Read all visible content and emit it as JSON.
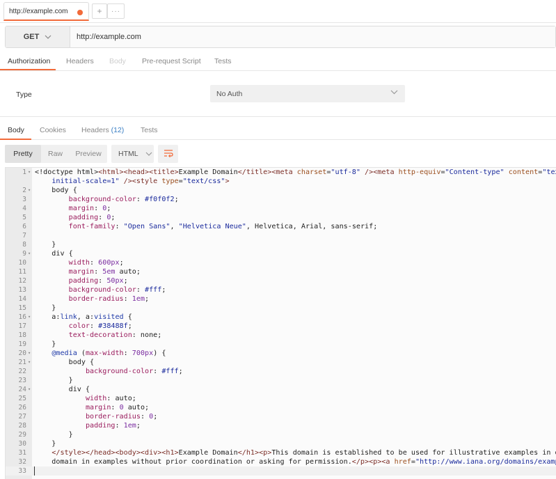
{
  "tab": {
    "url": "http://example.com",
    "add_label": "+",
    "more_label": "···"
  },
  "request": {
    "method": "GET",
    "url": "http://example.com"
  },
  "request_tabs": [
    "Authorization",
    "Headers",
    "Body",
    "Pre-request Script",
    "Tests"
  ],
  "auth": {
    "type_label": "Type",
    "type_value": "No Auth"
  },
  "response_tabs": {
    "body": "Body",
    "cookies": "Cookies",
    "headers": "Headers",
    "headers_count": "(12)",
    "tests": "Tests"
  },
  "body_toolbar": {
    "views": [
      "Pretty",
      "Raw",
      "Preview"
    ],
    "format": "HTML"
  },
  "colors": {
    "accent": "#f26b3a",
    "link": "#3a7fc4"
  },
  "icons": {
    "method_dropdown": "chevron-down-icon",
    "wrap": "wrap-lines-icon",
    "tab_unsaved": "dot-icon"
  },
  "code_lines": [
    {
      "n": "1",
      "fold": true,
      "html": "&lt;!doctype html&gt;<span class=\"tg\">&lt;html&gt;&lt;head&gt;&lt;title&gt;</span>Example Domain<span class=\"tg\">&lt;/title&gt;&lt;meta</span> <span class=\"at\">charset</span>=<span class=\"st\">\"utf-8\"</span> <span class=\"tg\">/&gt;&lt;meta</span> <span class=\"at\">http-equiv</span>=<span class=\"st\">\"Content-type\"</span> <span class=\"at\">content</span>=<span class=\"st\">\"text/html</span>"
    },
    {
      "n": "",
      "fold": false,
      "html": "    <span class=\"st\">initial-scale=1\"</span> <span class=\"tg\">/&gt;&lt;style</span> <span class=\"at\">type</span>=<span class=\"st\">\"text/css\"</span><span class=\"tg\">&gt;</span>"
    },
    {
      "n": "2",
      "fold": true,
      "html": "    body {"
    },
    {
      "n": "3",
      "fold": false,
      "html": "        <span class=\"pr\">background-color</span>: <span class=\"st\">#f0f0f2</span>;"
    },
    {
      "n": "4",
      "fold": false,
      "html": "        <span class=\"pr\">margin</span>: <span class=\"nm\">0</span>;"
    },
    {
      "n": "5",
      "fold": false,
      "html": "        <span class=\"pr\">padding</span>: <span class=\"nm\">0</span>;"
    },
    {
      "n": "6",
      "fold": false,
      "html": "        <span class=\"pr\">font-family</span>: <span class=\"st\">\"Open Sans\"</span>, <span class=\"st\">\"Helvetica Neue\"</span>, Helvetica, Arial, sans-serif;"
    },
    {
      "n": "7",
      "fold": false,
      "html": "        "
    },
    {
      "n": "8",
      "fold": false,
      "html": "    }"
    },
    {
      "n": "9",
      "fold": true,
      "html": "    div {"
    },
    {
      "n": "10",
      "fold": false,
      "html": "        <span class=\"pr\">width</span>: <span class=\"nm\">600px</span>;"
    },
    {
      "n": "11",
      "fold": false,
      "html": "        <span class=\"pr\">margin</span>: <span class=\"nm\">5em</span> auto;"
    },
    {
      "n": "12",
      "fold": false,
      "html": "        <span class=\"pr\">padding</span>: <span class=\"nm\">50px</span>;"
    },
    {
      "n": "13",
      "fold": false,
      "html": "        <span class=\"pr\">background-color</span>: <span class=\"st\">#fff</span>;"
    },
    {
      "n": "14",
      "fold": false,
      "html": "        <span class=\"pr\">border-radius</span>: <span class=\"nm\">1em</span>;"
    },
    {
      "n": "15",
      "fold": false,
      "html": "    }"
    },
    {
      "n": "16",
      "fold": true,
      "html": "    a:<span class=\"kw\">link</span>, a:<span class=\"kw\">visited</span> {"
    },
    {
      "n": "17",
      "fold": false,
      "html": "        <span class=\"pr\">color</span>: <span class=\"st\">#38488f</span>;"
    },
    {
      "n": "18",
      "fold": false,
      "html": "        <span class=\"pr\">text-decoration</span>: none;"
    },
    {
      "n": "19",
      "fold": false,
      "html": "    }"
    },
    {
      "n": "20",
      "fold": true,
      "html": "    <span class=\"kw\">@media</span> (<span class=\"pr\">max-width</span>: <span class=\"nm\">700px</span>) {"
    },
    {
      "n": "21",
      "fold": true,
      "html": "        body {"
    },
    {
      "n": "22",
      "fold": false,
      "html": "            <span class=\"pr\">background-color</span>: <span class=\"st\">#fff</span>;"
    },
    {
      "n": "23",
      "fold": false,
      "html": "        }"
    },
    {
      "n": "24",
      "fold": true,
      "html": "        div {"
    },
    {
      "n": "25",
      "fold": false,
      "html": "            <span class=\"pr\">width</span>: auto;"
    },
    {
      "n": "26",
      "fold": false,
      "html": "            <span class=\"pr\">margin</span>: <span class=\"nm\">0</span> auto;"
    },
    {
      "n": "27",
      "fold": false,
      "html": "            <span class=\"pr\">border-radius</span>: <span class=\"nm\">0</span>;"
    },
    {
      "n": "28",
      "fold": false,
      "html": "            <span class=\"pr\">padding</span>: <span class=\"nm\">1em</span>;"
    },
    {
      "n": "29",
      "fold": false,
      "html": "        }"
    },
    {
      "n": "30",
      "fold": false,
      "html": "    }"
    },
    {
      "n": "31",
      "fold": false,
      "html": "    <span class=\"tg\">&lt;/style&gt;&lt;/head&gt;&lt;body&gt;&lt;div&gt;&lt;h1&gt;</span>Example Domain<span class=\"tg\">&lt;/h1&gt;&lt;p&gt;</span>This domain is established to be used for illustrative examples in documen"
    },
    {
      "n": "32",
      "fold": false,
      "html": "    domain in examples without prior coordination or asking for permission.<span class=\"tg\">&lt;/p&gt;&lt;p&gt;&lt;a</span> <span class=\"at\">href</span>=<span class=\"st\">\"http://www.iana.org/domains/example\"</span><span class=\"tg\">&gt;</span>Mo"
    },
    {
      "n": "33",
      "fold": false,
      "current": true,
      "html": ""
    }
  ]
}
